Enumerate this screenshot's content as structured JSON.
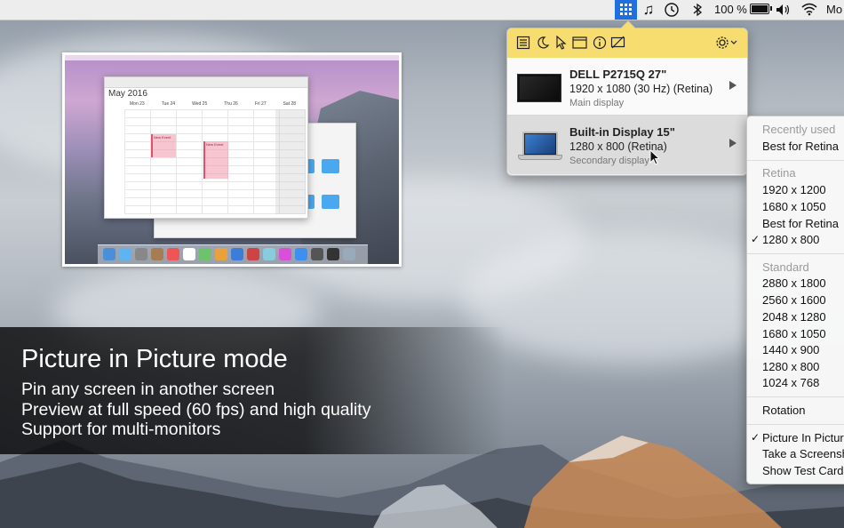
{
  "menubar": {
    "items": [
      "♫",
      "100 %",
      "Mo"
    ],
    "icons": [
      "displays-grid-icon",
      "music-note-icon",
      "time-machine-icon",
      "bluetooth-icon",
      "battery-icon",
      "volume-icon",
      "wifi-icon"
    ]
  },
  "pip_preview": {
    "calendar_title": "May 2016",
    "days": [
      "Mon 23",
      "Tue 24",
      "Wed 25",
      "Thu 26",
      "Fri 27",
      "Sat 28"
    ],
    "event_label": "New Event"
  },
  "caption": {
    "title": "Picture in Picture mode",
    "lines": [
      "Pin any screen in another screen",
      "Preview at full speed (60 fps) and high quality",
      "Support for multi-monitors"
    ]
  },
  "popover": {
    "toolbar_icons": [
      "list-icon",
      "moon-icon",
      "cursor-icon",
      "window-icon",
      "info-icon",
      "no-display-icon",
      "gear-icon"
    ],
    "displays": [
      {
        "name": "DELL P2715Q 27\"",
        "resolution": "1920 x 1080 (30 Hz) (Retina)",
        "role": "Main display"
      },
      {
        "name": "Built-in Display 15\"",
        "resolution": "1280 x 800 (Retina)",
        "role": "Secondary display"
      }
    ]
  },
  "menu": {
    "recent_header": "Recently used",
    "recent_items": [
      "Best for Retina"
    ],
    "retina_header": "Retina",
    "retina_items": [
      "1920 x 1200",
      "1680 x 1050",
      "Best for Retina",
      "1280 x 800"
    ],
    "standard_header": "Standard",
    "standard_items": [
      "2880 x 1800",
      "2560 x 1600",
      "2048 x 1280",
      "1680 x 1050",
      "1440 x 900",
      "1280 x 800",
      "1024 x 768"
    ],
    "rotation": "Rotation",
    "bottom_items": [
      "Picture In Pictur",
      "Take a Screensh",
      "Show Test Card"
    ],
    "checked": [
      "1280 x 800",
      "Picture In Pictur"
    ]
  },
  "colors": {
    "toolbar_yellow": "#f7dc6f",
    "menubar_accent": "#1f6fe0"
  }
}
